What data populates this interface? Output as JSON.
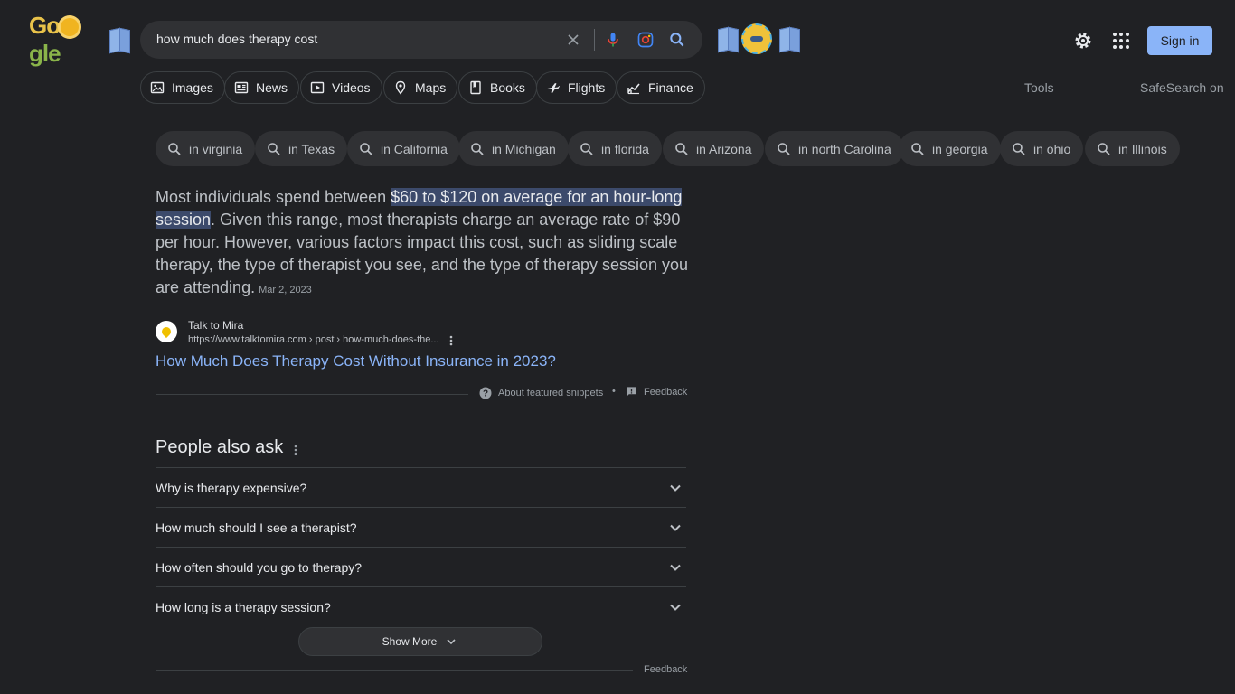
{
  "logo": {
    "text_left": "Go",
    "text_right": "gle"
  },
  "search": {
    "value": "how much does therapy cost",
    "icons": [
      "clear-icon",
      "mic-icon",
      "lens-icon",
      "search-icon"
    ]
  },
  "header": {
    "sign_in": "Sign in",
    "settings_icon": "gear-icon",
    "apps_icon": "apps-grid-icon"
  },
  "tabs": [
    {
      "label": "Images",
      "icon": "image-icon"
    },
    {
      "label": "News",
      "icon": "news-icon"
    },
    {
      "label": "Videos",
      "icon": "video-icon"
    },
    {
      "label": "Maps",
      "icon": "map-pin-icon"
    },
    {
      "label": "Books",
      "icon": "book-icon"
    },
    {
      "label": "Flights",
      "icon": "plane-icon"
    },
    {
      "label": "Finance",
      "icon": "finance-icon"
    }
  ],
  "toolbar": {
    "tools": "Tools",
    "safesearch": "SafeSearch on"
  },
  "chips": [
    "in virginia",
    "in Texas",
    "in California",
    "in Michigan",
    "in florida",
    "in Arizona",
    "in north Carolina",
    "in georgia",
    "in ohio",
    "in Illinois"
  ],
  "snippet": {
    "before": "Most individuals spend between ",
    "highlight": "$60 to $120 on average for an hour-long session",
    "after": ". Given this range, most therapists charge an average rate of $90 per hour. However, various factors impact this cost, such as sliding scale therapy, the type of therapist you see, and the type of therapy session you are attending.",
    "date": "Mar 2, 2023"
  },
  "source": {
    "name": "Talk to Mira",
    "url": "https://www.talktomira.com › post › how-much-does-the..."
  },
  "result_title": "How Much Does Therapy Cost Without Insurance in 2023?",
  "snippet_footer": {
    "about": "About featured snippets",
    "separator": "•",
    "feedback": "Feedback"
  },
  "paa": {
    "title": "People also ask",
    "questions": [
      "Why is therapy expensive?",
      "How much should I see a therapist?",
      "How often should you go to therapy?",
      "How long is a therapy session?"
    ],
    "show_more": "Show More"
  },
  "bottom_feedback": "Feedback",
  "colors": {
    "background": "#202124",
    "link": "#8ab4f8",
    "chip": "#303134",
    "highlight": "#3c4a6b"
  }
}
